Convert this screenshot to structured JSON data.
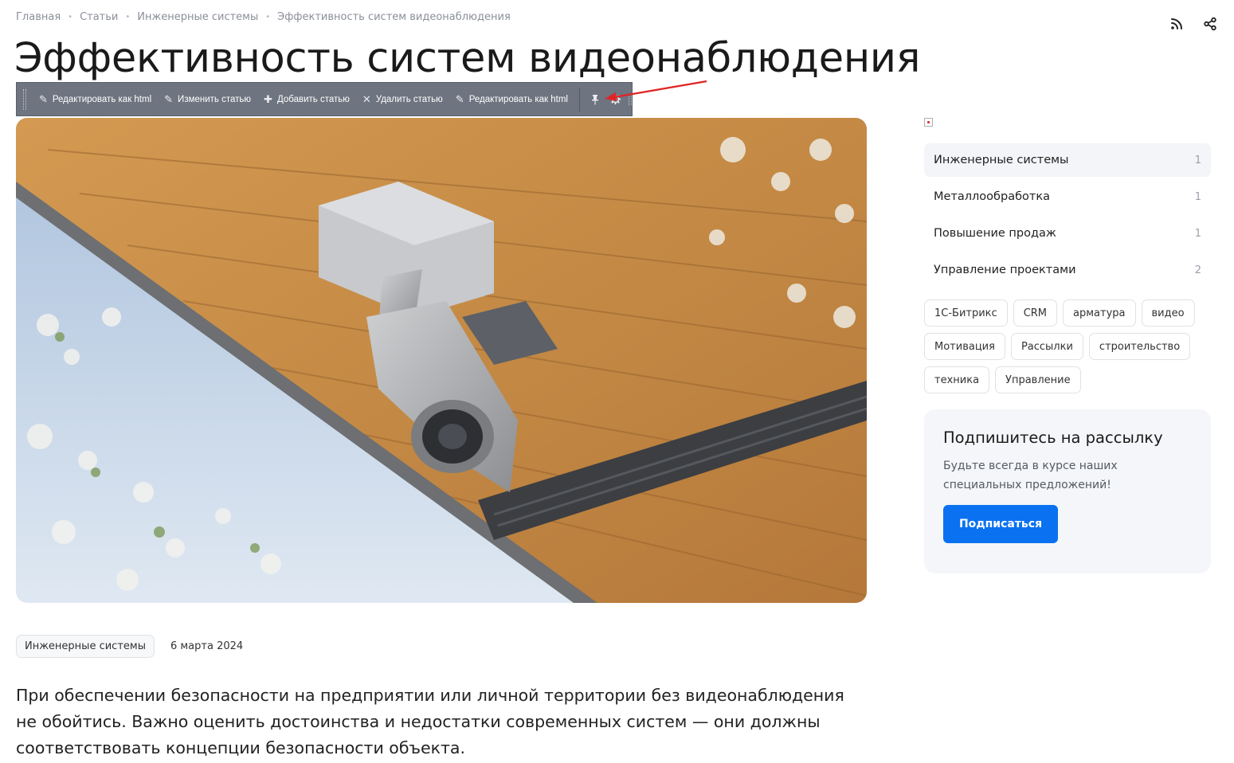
{
  "breadcrumb": [
    "Главная",
    "Статьи",
    "Инженерные системы",
    "Эффективность систем видеонаблюдения"
  ],
  "breadcrumb_separator": "•",
  "page_title": "Эффективность систем видеонаблюдения",
  "top_icons": [
    "rss-icon",
    "share-icon"
  ],
  "admin_toolbar": {
    "buttons": [
      {
        "label": "Редактировать как html",
        "icon": "pencil-icon"
      },
      {
        "label": "Изменить статью",
        "icon": "pencil-icon"
      },
      {
        "label": "Добавить статью",
        "icon": "plus-icon"
      },
      {
        "label": "Удалить статью",
        "icon": "close-icon"
      },
      {
        "label": "Редактировать как html",
        "icon": "pencil-icon"
      }
    ],
    "pin_icon": "pin-icon",
    "settings_icon": "gear-icon"
  },
  "annotation_color": "#e02424",
  "meta": {
    "tag": "Инженерные системы",
    "date": "6 марта 2024"
  },
  "intro_text": "При обеспечении безопасности на предприятии или личной территории без видеонаблюдения не обойтись. Важно оценить достоинства и недостатки современных систем — они должны соответствовать концепции безопасности объекта.",
  "sidebar": {
    "categories": [
      {
        "name": "Инженерные системы",
        "count": "1",
        "active": true
      },
      {
        "name": "Металлообработка",
        "count": "1",
        "active": false
      },
      {
        "name": "Повышение продаж",
        "count": "1",
        "active": false
      },
      {
        "name": "Управление проектами",
        "count": "2",
        "active": false
      }
    ],
    "tags": [
      "1С-Битрикс",
      "CRM",
      "арматура",
      "видео",
      "Мотивация",
      "Рассылки",
      "строительство",
      "техника",
      "Управление"
    ],
    "subscribe": {
      "title": "Подпишитесь на рассылку",
      "text": "Будьте всегда в курсе наших специальных предложений!",
      "button": "Подписаться"
    }
  },
  "colors": {
    "accent": "#0a72f0",
    "toolbar_bg": "#6e7480"
  }
}
